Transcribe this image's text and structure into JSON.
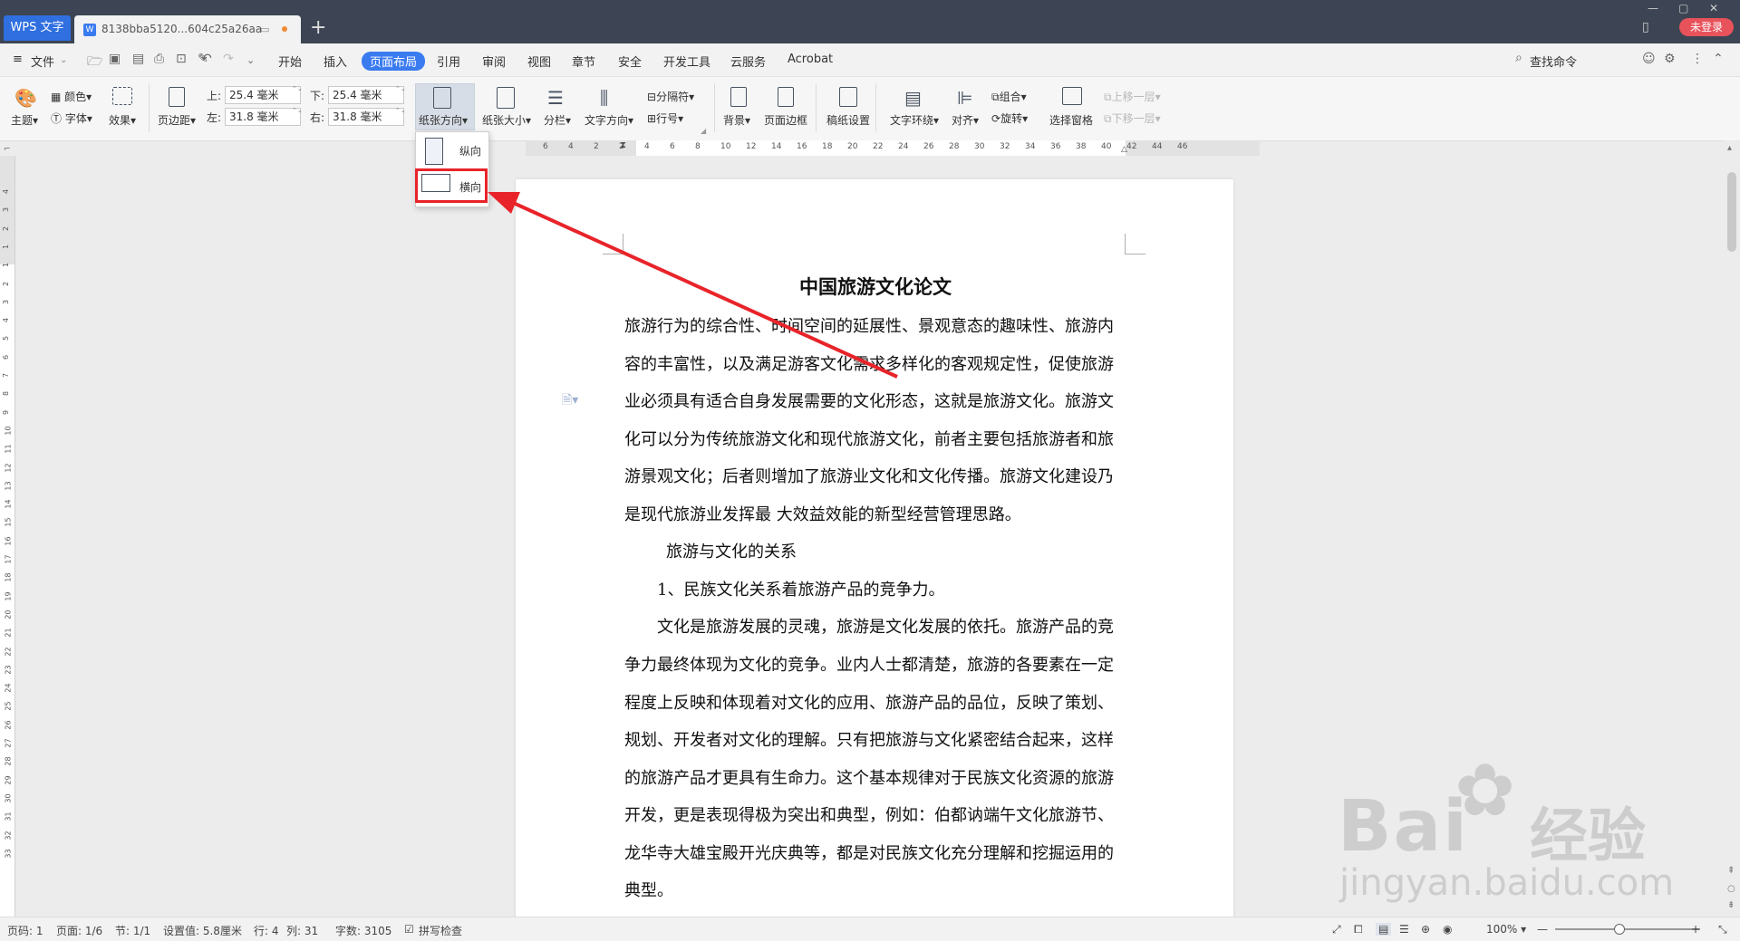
{
  "titlebar": {
    "app_tab": "WPS 文字",
    "doc_tab": "8138bba5120...604c25a26aa",
    "login_badge": "未登录"
  },
  "menu": {
    "file": "文件",
    "items": [
      "开始",
      "插入",
      "页面布局",
      "引用",
      "审阅",
      "视图",
      "章节",
      "安全",
      "开发工具",
      "云服务",
      "Acrobat"
    ],
    "active": "页面布局",
    "search": "查找命令"
  },
  "ribbon": {
    "theme": "主题",
    "color": "颜色",
    "font": "字体",
    "effect": "效果",
    "margin": "页边距",
    "top_label": "上:",
    "top_value": "25.4 毫米",
    "bottom_label": "下:",
    "bottom_value": "25.4 毫米",
    "left_label": "左:",
    "left_value": "31.8 毫米",
    "right_label": "右:",
    "right_value": "31.8 毫米",
    "orientation": "纸张方向",
    "size": "纸张大小",
    "columns": "分栏",
    "text_direction": "文字方向",
    "separator": "分隔符",
    "line_number": "行号",
    "background": "背景",
    "page_border": "页面边框",
    "draft_settings": "稿纸设置",
    "text_wrap": "文字环绕",
    "align": "对齐",
    "group": "组合",
    "rotate": "旋转",
    "selection_pane": "选择窗格",
    "bring_forward": "上移一层",
    "send_backward": "下移一层"
  },
  "orientation_menu": {
    "portrait": "纵向",
    "landscape": "横向"
  },
  "ruler": {
    "h_ticks": [
      "6",
      "4",
      "2",
      "2",
      "4",
      "6",
      "8",
      "10",
      "12",
      "14",
      "16",
      "18",
      "20",
      "22",
      "24",
      "26",
      "28",
      "30",
      "32",
      "34",
      "36",
      "38",
      "40",
      "42",
      "44",
      "46"
    ],
    "v_ticks": [
      "4",
      "3",
      "2",
      "1",
      "1",
      "2",
      "3",
      "4",
      "5",
      "6",
      "7",
      "8",
      "9",
      "10",
      "11",
      "12",
      "13",
      "14",
      "15",
      "16",
      "17",
      "18",
      "19",
      "20",
      "21",
      "22",
      "23",
      "24",
      "25",
      "26",
      "27",
      "28",
      "29",
      "30",
      "31",
      "32",
      "33"
    ]
  },
  "document": {
    "title": "中国旅游文化论文",
    "lines": [
      "旅游行为的综合性、时间空间的延展性、景观意态的趣味性、旅游内",
      "容的丰富性，以及满足游客文化需求多样化的客观规定性，促使旅游",
      "业必须具有适合自身发展需要的文化形态，这就是旅游文化。旅游文",
      "化可以分为传统旅游文化和现代旅游文化，前者主要包括旅游者和旅",
      "游景观文化；后者则增加了旅游业文化和文化传播。旅游文化建设乃",
      "是现代旅游业发挥最  大效益效能的新型经营管理思路。",
      "旅游与文化的关系",
      "1、民族文化关系着旅游产品的竞争力。",
      "文化是旅游发展的灵魂，旅游是文化发展的依托。旅游产品的竞",
      "争力最终体现为文化的竞争。业内人士都清楚，旅游的各要素在一定",
      "程度上反映和体现着对文化的应用、旅游产品的品位，反映了策划、",
      "规划、开发者对文化的理解。只有把旅游与文化紧密结合起来，这样",
      "的旅游产品才更具有生命力。这个基本规律对于民族文化资源的旅游",
      "开发，更是表现得极为突出和典型，例如：伯都讷端午文化旅游节、",
      "龙华寺大雄宝殿开光庆典等，都是对民族文化充分理解和挖掘运用的",
      "典型。"
    ]
  },
  "status": {
    "page_code": "页码: 1",
    "pages": "页面: 1/6",
    "section": "节: 1/1",
    "setting": "设置值: 5.8厘米",
    "row": "行: 4",
    "col": "列: 31",
    "words": "字数: 3105",
    "spell": "拼写检查",
    "zoom": "100%"
  },
  "watermark": {
    "logo_left": "Bai",
    "logo_right": "经验",
    "url": "jingyan.baidu.com"
  },
  "colors": {
    "titlebar": "#3d4554",
    "accent": "#3a7bf0",
    "highlight_red": "#e8242a",
    "login": "#e8525b"
  }
}
